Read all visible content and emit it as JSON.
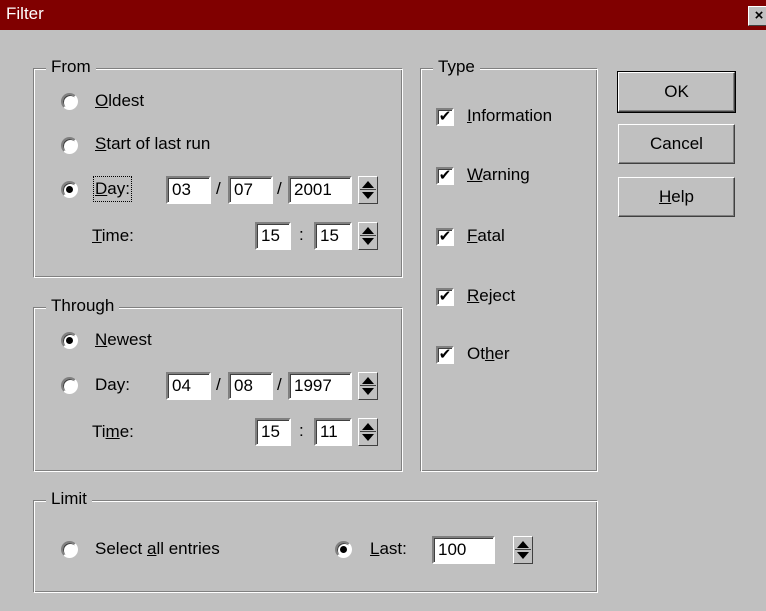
{
  "window": {
    "title": "Filter",
    "close_label": "×"
  },
  "from": {
    "legend": "From",
    "oldest": "Oldest",
    "start_of_last_run": "Start of last run",
    "day_label": "Day:",
    "time_label": "Time:",
    "day": {
      "month": "03",
      "day": "07",
      "year": "2001"
    },
    "time": {
      "hour": "15",
      "minute": "15"
    },
    "selected": "day"
  },
  "through": {
    "legend": "Through",
    "newest": "Newest",
    "day_label": "Day:",
    "time_label": "Time:",
    "day": {
      "month": "04",
      "day": "08",
      "year": "1997"
    },
    "time": {
      "hour": "15",
      "minute": "11"
    },
    "selected": "newest"
  },
  "type": {
    "legend": "Type",
    "items": [
      {
        "label": "Information",
        "checked": true
      },
      {
        "label": "Warning",
        "checked": true
      },
      {
        "label": "Fatal",
        "checked": true
      },
      {
        "label": "Reject",
        "checked": true
      },
      {
        "label": "Other",
        "checked": true
      }
    ]
  },
  "limit": {
    "legend": "Limit",
    "select_all": "Select all entries",
    "last_label": "Last:",
    "last_value": "100",
    "selected": "last"
  },
  "buttons": {
    "ok": "OK",
    "cancel": "Cancel",
    "help": "Help"
  },
  "separators": {
    "date": "/",
    "time": ":"
  },
  "check_glyph": "✔",
  "colors": {
    "titlebar": "#800000",
    "face": "#c0c0c0"
  }
}
